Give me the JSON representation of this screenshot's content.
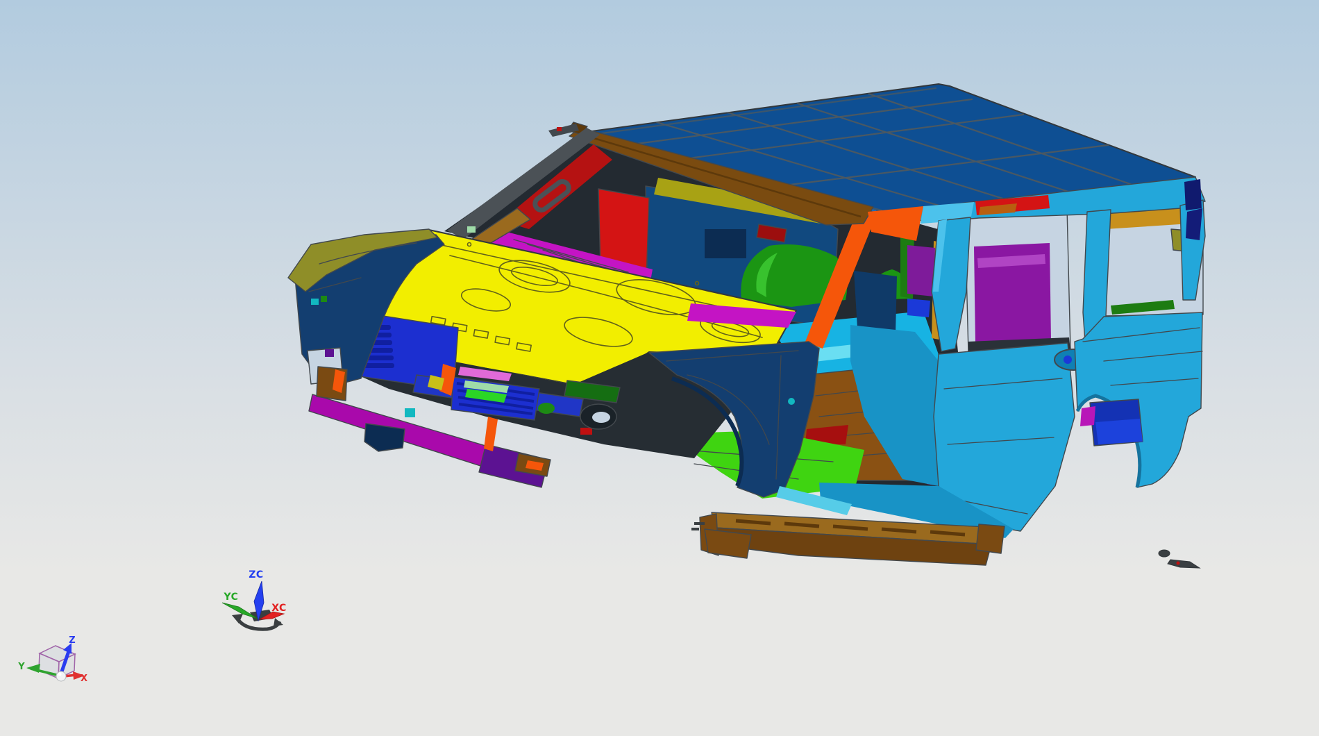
{
  "viewport": {
    "type": "cad-3d-viewport",
    "background": {
      "top": "#b2cbdf",
      "mid": "#d9dfe4",
      "bottom": "#e8e8e6"
    }
  },
  "colors": {
    "bg_top": "#b2cbdf",
    "bg_mid": "#d9dfe4",
    "bg_bottom": "#e8e8e6",
    "edge": "#42484d",
    "edge_dark": "#33383c",
    "roof_blue": "#0e4f93",
    "roof_line": "#4a5862",
    "roof_hilite": "#2f74b8",
    "header_brown": "#7a4b10",
    "brown": "#7a4a12",
    "brown_dark": "#5d390b",
    "brown_light": "#9a6a1e",
    "floor_brown": "#8a5113",
    "hood_yellow": "#f2ee00",
    "hood_edge": "#d8d400",
    "hood_line": "#62621a",
    "olive": "#8f8e28",
    "olive_strip": "#a8a214",
    "cowl_magenta": "#c414c4",
    "magenta_trim": "#b816b8",
    "bumper_magenta": "#a909ab",
    "purple": "#5c1292",
    "cargo_purple": "#8a17a2",
    "pillar_purple": "#7e1b9a",
    "red": "#d41414",
    "dark_red": "#9c0e0e",
    "red_chip": "#c01010",
    "pillar_red": "#b51212",
    "orange": "#f5560a",
    "orange_brown": "#b85f10",
    "side_cyan": "#23a7da",
    "side_cyan_light": "#4cc2ec",
    "side_cyan_dark": "#1893c6",
    "sill_teal": "#56cce8",
    "fender_navy": "#133e70",
    "navy_dark": "#0c2c52",
    "dash_navy": "#11497f",
    "navy_box": "#0f3a68",
    "glass_navy": "#101a6e",
    "grille_blue": "#1c2fd0",
    "grille_dark": "#101fa0",
    "blue_bar": "#2036c6",
    "blue_chip": "#1b39d8",
    "arch_blue": "#1432b4",
    "arch_blue2": "#1c42dc",
    "seat_green": "#1b9513",
    "seat_hilite": "#38c22e",
    "green_dark": "#156e12",
    "green_strip": "#1d7c12",
    "floor_green": "#3fd411",
    "green_oval": "#1d8a14",
    "cyan_floor": "#17b3e3",
    "teal": "#12b8c0",
    "tan": "#c8901c",
    "pink": "#e06ad8",
    "mint": "#9fdca8",
    "lt_green": "#2bd626",
    "yellow_chip": "#c8c018",
    "sky_through": "#c6d4e2",
    "interior_dark": "#232a31",
    "cavity": "#262d33",
    "debris": "#3a3f42",
    "ax_x": "#e03030",
    "ax_y": "#2fa32f",
    "ax_z": "#2a3cf0",
    "wcs_x": "#e22222",
    "wcs_y": "#28a828",
    "wcs_z": "#2440f0",
    "cube_edge": "#a064a8",
    "cube_fill": "#d8dce0",
    "sphere": "#f2f4f5",
    "rot_gray": "#3a3e40"
  },
  "model": {
    "name": "suv-body-in-white",
    "parts": [
      {
        "name": "roof-panel",
        "color": "#0e4f93"
      },
      {
        "name": "windshield-header-rail",
        "color": "#7a4b10"
      },
      {
        "name": "hood-panel",
        "color": "#f2ee00"
      },
      {
        "name": "cowl-panel",
        "color": "#c414c4"
      },
      {
        "name": "left-fender",
        "color": "#133e70"
      },
      {
        "name": "left-fender-rail",
        "color": "#8f8e28"
      },
      {
        "name": "right-fender",
        "color": "#133e70"
      },
      {
        "name": "grille-radiator-support",
        "color": "#1c2fd0"
      },
      {
        "name": "front-bumper-beam",
        "color": "#a909ab"
      },
      {
        "name": "a-pillar-right",
        "color": "#f5560a"
      },
      {
        "name": "a-pillar-left-inner",
        "color": "#b51212"
      },
      {
        "name": "dash-structure",
        "color": "#11497f"
      },
      {
        "name": "front-seat",
        "color": "#1b9513"
      },
      {
        "name": "front-floor",
        "color": "#17b3e3"
      },
      {
        "name": "mid-floor-pan",
        "color": "#8a5113"
      },
      {
        "name": "under-fender-floor",
        "color": "#3fd411"
      },
      {
        "name": "bodyside-outer",
        "color": "#23a7da"
      },
      {
        "name": "roof-rail-red-bow",
        "color": "#d41414"
      },
      {
        "name": "quarter-rail-trim",
        "color": "#c8901c"
      },
      {
        "name": "cargo-wheelhouse-trim",
        "color": "#8a17a2"
      },
      {
        "name": "b-pillar-trim",
        "color": "#b816b8"
      },
      {
        "name": "rear-arch-bracket",
        "color": "#1432b4"
      },
      {
        "name": "running-board",
        "color": "#7a4a12"
      },
      {
        "name": "floating-debris",
        "color": "#3a3f42"
      }
    ]
  },
  "wcs_triad": {
    "z_label": "ZC",
    "y_label": "YC",
    "x_label": "XC"
  },
  "view_triad": {
    "z_label": "Z",
    "y_label": "Y",
    "x_label": "X"
  }
}
